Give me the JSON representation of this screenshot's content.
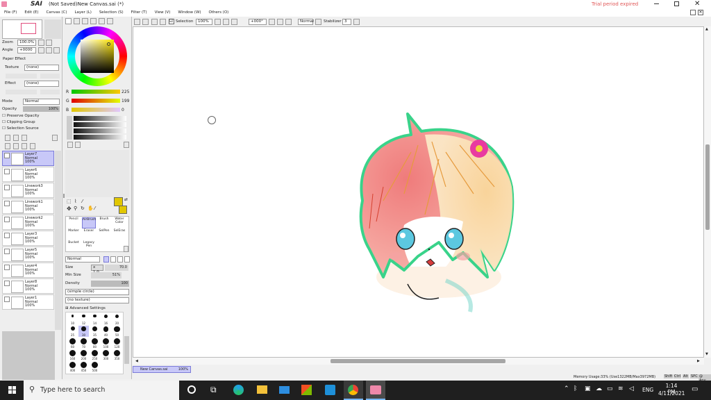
{
  "window": {
    "app_name": "SAI",
    "title": "(Not Saved)New Canvas.sai (*)",
    "trial_notice": "Trial period expired",
    "controls": [
      "minimize",
      "maximize",
      "close"
    ]
  },
  "menu": [
    "File (F)",
    "Edit (E)",
    "Canvas (C)",
    "Layer (L)",
    "Selection (S)",
    "Filter (T)",
    "View (V)",
    "Window (W)",
    "Others (O)"
  ],
  "toolbar": {
    "selection_label": "Selection",
    "zoom": "100%",
    "rotation": "+000°",
    "blend": "Normal",
    "stabilizer_label": "Stabilizer",
    "stabilizer_value": "3"
  },
  "navigator": {
    "zoom_label": "Zoom",
    "zoom_value": "100.0%",
    "angle_label": "Angle",
    "angle_value": "+0000"
  },
  "paper_effect": {
    "header": "Paper Effect",
    "texture_label": "Texture",
    "texture_value": "(none)",
    "effect_label": "Effect",
    "effect_value": "(none)"
  },
  "layer_props": {
    "mode_label": "Mode",
    "mode_value": "Normal",
    "opacity_label": "Opacity",
    "opacity_value": "100%",
    "preserve_opacity": "Preserve Opacity",
    "clipping_group": "Clipping Group",
    "selection_source": "Selection Source"
  },
  "layers": [
    {
      "name": "Layer7",
      "mode": "Normal",
      "opacity": "100%",
      "selected": true
    },
    {
      "name": "Layer6",
      "mode": "Normal",
      "opacity": "100%",
      "selected": false
    },
    {
      "name": "Linework3",
      "mode": "Normal",
      "opacity": "100%",
      "selected": false
    },
    {
      "name": "Linework1",
      "mode": "Normal",
      "opacity": "100%",
      "selected": false
    },
    {
      "name": "Linework2",
      "mode": "Normal",
      "opacity": "100%",
      "selected": false
    },
    {
      "name": "Layer3",
      "mode": "Normal",
      "opacity": "100%",
      "selected": false
    },
    {
      "name": "Layer5",
      "mode": "Normal",
      "opacity": "100%",
      "selected": false
    },
    {
      "name": "Layer4",
      "mode": "Normal",
      "opacity": "100%",
      "selected": false
    },
    {
      "name": "Layer8",
      "mode": "Normal",
      "opacity": "100%",
      "selected": false
    },
    {
      "name": "Layer1",
      "mode": "Normal",
      "opacity": "100%",
      "selected": false
    }
  ],
  "color": {
    "current_hex": "#e1c700",
    "r_label": "R",
    "r_value": "225",
    "g_label": "G",
    "g_value": "199",
    "b_label": "B",
    "b_value": "0"
  },
  "tools": [
    {
      "name": "Pencil"
    },
    {
      "name": "AirBrush"
    },
    {
      "name": "Brush"
    },
    {
      "name": "Water Color"
    },
    {
      "name": "Marker"
    },
    {
      "name": "Eraser"
    },
    {
      "name": "SelPen"
    },
    {
      "name": "SelEras"
    },
    {
      "name": "Bucket"
    },
    {
      "name": "Legacy Pen"
    }
  ],
  "brush": {
    "mode_value": "Normal",
    "size_label": "Size",
    "size_mult": "x 1.0",
    "size_value": "70.0",
    "min_size_label": "Min Size",
    "min_size_value": "51%",
    "density_label": "Density",
    "density_value": "100",
    "shape_value": "(simple circle)",
    "texture_value": "(no texture)",
    "advanced_label": "Advanced Settings",
    "sizes": [
      "10",
      "12",
      "14",
      "16",
      "20",
      "25",
      "30",
      "35",
      "40",
      "50",
      "60",
      "70",
      "80",
      "100",
      "120",
      "160",
      "200",
      "250",
      "300",
      "350",
      "400",
      "450",
      "500"
    ]
  },
  "canvas_tab": {
    "name": "New Canvas.sai",
    "zoom": "100%"
  },
  "status_bar": {
    "memory": "Memory Usage:33% (Use1322MB/Max3972MB)",
    "indicators": [
      "Shift",
      "Ctrl",
      "Alt",
      "SPC",
      "@ Any",
      "Wnd"
    ]
  },
  "taskbar": {
    "search_placeholder": "Type here to search",
    "time": "1:14 PM",
    "date": "4/11/2021",
    "lang": "ENG"
  }
}
